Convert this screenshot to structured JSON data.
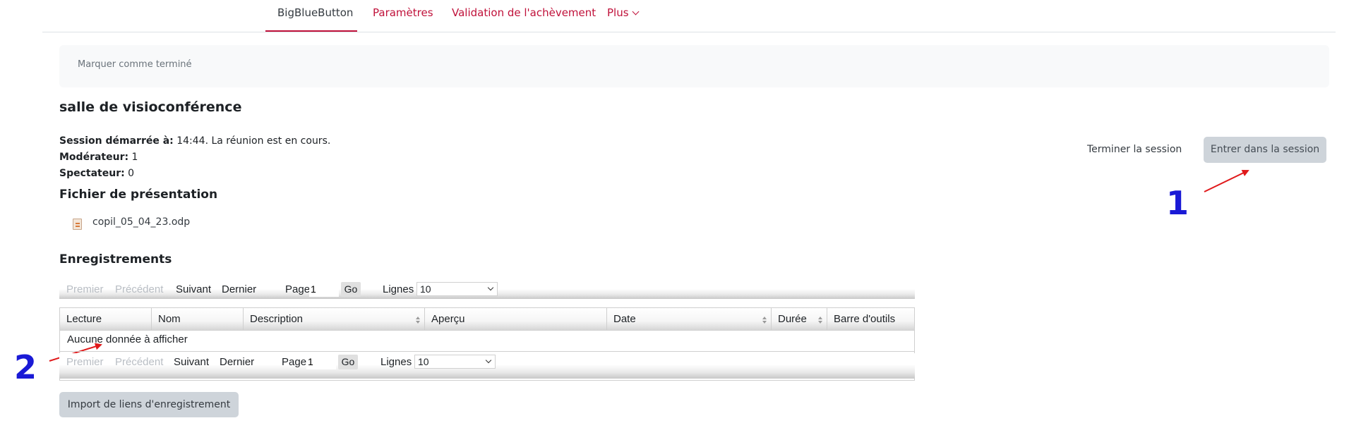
{
  "nav": {
    "items": [
      {
        "label": "BigBlueButton",
        "active": true
      },
      {
        "label": "Paramètres",
        "active": false
      },
      {
        "label": "Validation de l'achèvement",
        "active": false
      },
      {
        "label": "Plus",
        "active": false
      }
    ]
  },
  "completion": {
    "label": "Marquer comme terminé"
  },
  "room": {
    "title": "salle de visioconférence",
    "session_label": "Session démarrée à:",
    "session_value": " 14:44. La réunion est en cours.",
    "moderator_label": "Modérateur:",
    "moderator_value": " 1",
    "viewer_label": "Spectateur:",
    "viewer_value": " 0"
  },
  "presentation": {
    "heading": "Fichier de présentation",
    "file": "copil_05_04_23.odp",
    "file_icon": "document-icon"
  },
  "actions": {
    "end_session": "Terminer la session",
    "join_session": "Entrer dans la session"
  },
  "recordings": {
    "heading": "Enregistrements",
    "pager": {
      "first": "Premier",
      "previous": "Précédent",
      "next": "Suivant",
      "last": "Dernier",
      "page_label": "Page",
      "page_value": "1",
      "go": "Go",
      "rows_label": "Lignes",
      "rows_value": "10"
    },
    "columns": [
      "Lecture",
      "Nom",
      "Description",
      "Aperçu",
      "Date",
      "Durée",
      "Barre d'outils"
    ],
    "empty_message": "Aucune donnée à afficher",
    "import_button": "Import de liens d'enregistrement"
  },
  "annotations": {
    "one": "1",
    "two": "2",
    "color_number": "#1a1ad6",
    "color_arrow": "#e0191b"
  }
}
